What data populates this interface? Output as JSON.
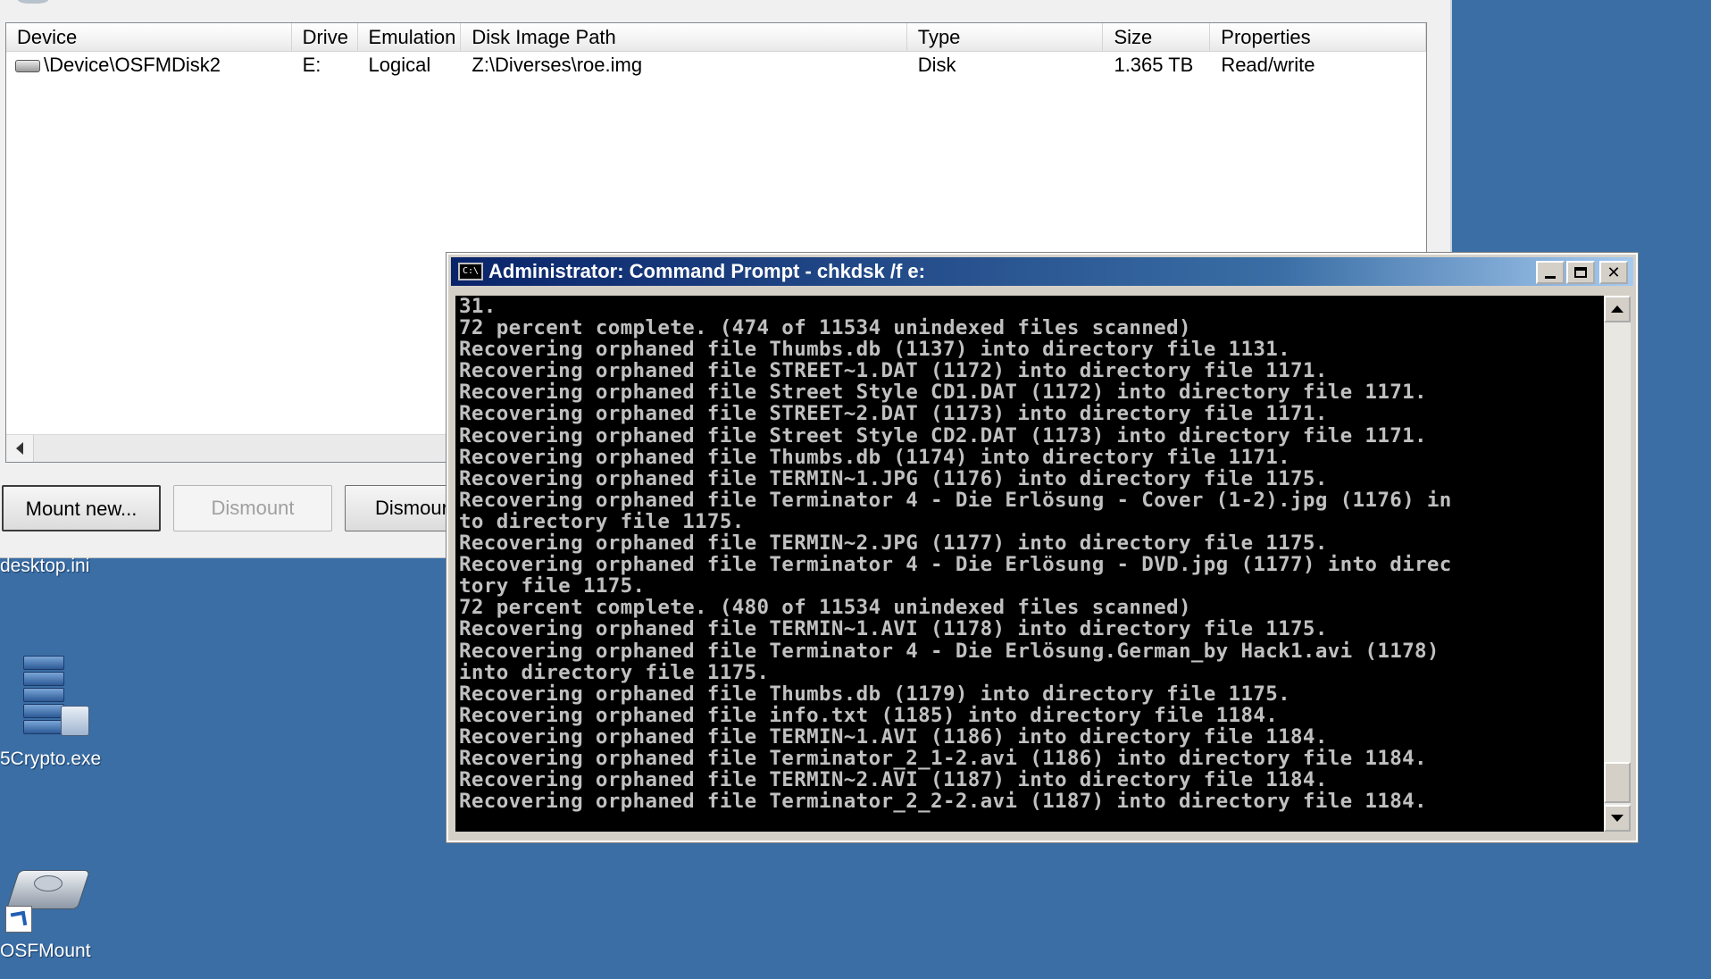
{
  "osfmount": {
    "columns": [
      {
        "label": "Device"
      },
      {
        "label": "Drive"
      },
      {
        "label": "Emulation"
      },
      {
        "label": "Disk Image Path"
      },
      {
        "label": "Type"
      },
      {
        "label": "Size"
      },
      {
        "label": "Properties"
      }
    ],
    "rows": [
      {
        "device": "\\Device\\OSFMDisk2",
        "drive": "E:",
        "emulation": "Logical",
        "path": "Z:\\Diverses\\roe.img",
        "type": "Disk",
        "size": "1.365 TB",
        "properties": "Read/write"
      }
    ],
    "buttons": {
      "mount_new": "Mount new...",
      "dismount": "Dismount",
      "dismount_all": "Dismour"
    }
  },
  "desktop": {
    "icons": [
      {
        "label": "desktop.ini"
      },
      {
        "label": "5Crypto.exe"
      },
      {
        "label": "OSFMount"
      }
    ]
  },
  "cmd": {
    "title": "Administrator: Command Prompt - chkdsk  /f e:",
    "icon_text": "C:\\",
    "lines": [
      "31.",
      "72 percent complete. (474 of 11534 unindexed files scanned)",
      "Recovering orphaned file Thumbs.db (1137) into directory file 1131.",
      "Recovering orphaned file STREET~1.DAT (1172) into directory file 1171.",
      "Recovering orphaned file Street Style CD1.DAT (1172) into directory file 1171.",
      "Recovering orphaned file STREET~2.DAT (1173) into directory file 1171.",
      "Recovering orphaned file Street Style CD2.DAT (1173) into directory file 1171.",
      "Recovering orphaned file Thumbs.db (1174) into directory file 1171.",
      "Recovering orphaned file TERMIN~1.JPG (1176) into directory file 1175.",
      "Recovering orphaned file Terminator 4 - Die Erlösung - Cover (1-2).jpg (1176) in",
      "to directory file 1175.",
      "Recovering orphaned file TERMIN~2.JPG (1177) into directory file 1175.",
      "Recovering orphaned file Terminator 4 - Die Erlösung - DVD.jpg (1177) into direc",
      "tory file 1175.",
      "72 percent complete. (480 of 11534 unindexed files scanned)",
      "Recovering orphaned file TERMIN~1.AVI (1178) into directory file 1175.",
      "Recovering orphaned file Terminator 4 - Die Erlösung.German_by Hack1.avi (1178)",
      "into directory file 1175.",
      "Recovering orphaned file Thumbs.db (1179) into directory file 1175.",
      "Recovering orphaned file info.txt (1185) into directory file 1184.",
      "Recovering orphaned file TERMIN~1.AVI (1186) into directory file 1184.",
      "Recovering orphaned file Terminator_2_1-2.avi (1186) into directory file 1184.",
      "Recovering orphaned file TERMIN~2.AVI (1187) into directory file 1184.",
      "Recovering orphaned file Terminator_2_2-2.avi (1187) into directory file 1184."
    ]
  }
}
